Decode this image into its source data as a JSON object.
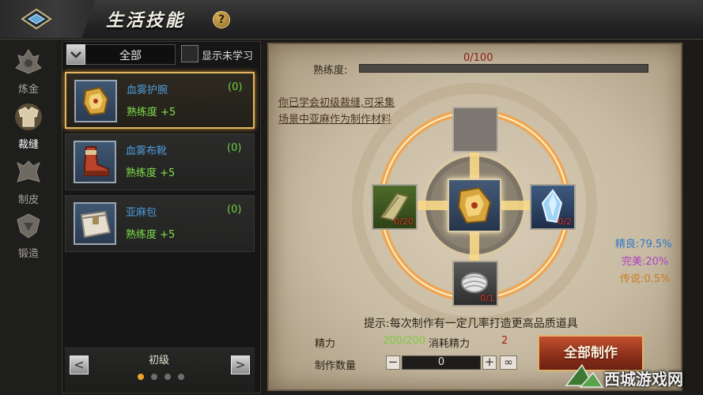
{
  "header": {
    "title": "生活技能",
    "help_icon": "?"
  },
  "sidebar": {
    "items": [
      {
        "label": "炼金",
        "icon": "alchemy-icon"
      },
      {
        "label": "裁缝",
        "icon": "tailoring-icon",
        "active": true
      },
      {
        "label": "制皮",
        "icon": "leatherwork-icon"
      },
      {
        "label": "锻造",
        "icon": "forging-icon"
      }
    ]
  },
  "filter": {
    "selected": "全部",
    "show_unlearned_label": "显示未学习"
  },
  "recipes": [
    {
      "name": "血雾护腕",
      "count": "(0)",
      "proficiency": "熟练度 +5",
      "icon": "bracer-icon",
      "selected": true
    },
    {
      "name": "血雾布靴",
      "count": "(0)",
      "proficiency": "熟练度 +5",
      "icon": "boots-icon"
    },
    {
      "name": "亚麻包",
      "count": "(0)",
      "proficiency": "熟练度 +5",
      "icon": "linen-bag-icon"
    }
  ],
  "tier": {
    "label": "初级",
    "prev": "<",
    "next": ">",
    "page": 1,
    "pages": 4
  },
  "craft": {
    "proficiency_label": "熟练度:",
    "proficiency_value": "0/100",
    "proficiency_fraction": 0,
    "description": "你已学会初级裁缝,可采集场景中亚麻作为制作材料",
    "materials": {
      "left": {
        "qty": "0/20",
        "icon": "cloth-material-icon"
      },
      "right": {
        "qty": "0/2",
        "icon": "crystal-icon"
      },
      "bottom": {
        "qty": "0/1",
        "icon": "thread-icon"
      }
    },
    "rates": {
      "fine": "精良:79.5%",
      "perfect": "完美:20%",
      "legendary": "传说:0.5%"
    },
    "hint": "提示:每次制作有一定几率打造更高品质道具",
    "energy_label": "精力",
    "energy_value": "200/200",
    "cost_label": "消耗精力",
    "cost_value": "2",
    "quantity_label": "制作数量",
    "quantity_minus": "−",
    "quantity_value": "0",
    "quantity_plus": "+",
    "quantity_max": "∞",
    "craft_all_label": "全部制作"
  },
  "watermark": "西城游戏网",
  "colors": {
    "selected_border": "#e1b660",
    "name_blue": "#4e9bd8",
    "green": "#7fe04a",
    "red": "#a51d13",
    "button_red": "#8a2e19"
  }
}
